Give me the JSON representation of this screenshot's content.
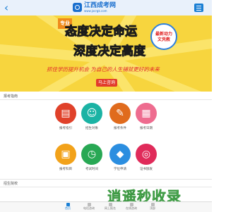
{
  "header": {
    "back_glyph": "‹",
    "logo_text": "江西成考网",
    "logo_sub": "www.jxcrgk.com",
    "menu_label": "menu"
  },
  "banner": {
    "tag": "专业",
    "headline_1": "态度决定命运",
    "headline_2": "深度决定高度",
    "badge": "最新动力\n文凭教",
    "slogan": "抓住学历提升机会 为自己的人生铺就更好的未来",
    "cta": "马上咨询",
    "colors": {
      "background": "#f7d53e",
      "tag": "#f08a1a",
      "cta": "#e23b2b"
    }
  },
  "sections": {
    "guide_title": "报考指南",
    "service_title": "招生院校"
  },
  "grid": [
    {
      "label": "报考指引",
      "icon": "document-icon",
      "color": "#e0412a"
    },
    {
      "label": "招生对象",
      "icon": "person-icon",
      "color": "#1bb3a4"
    },
    {
      "label": "报考条件",
      "icon": "certificate-icon",
      "color": "#e06b1d"
    },
    {
      "label": "报考日期",
      "icon": "calendar-icon",
      "color": "#ee6c8f"
    },
    {
      "label": "报考科目",
      "icon": "book-icon",
      "color": "#f2a21a"
    },
    {
      "label": "考试时间",
      "icon": "clock-icon",
      "color": "#28a854"
    },
    {
      "label": "学位申请",
      "icon": "graduation-cap-icon",
      "color": "#2b8ee0"
    },
    {
      "label": "证书颁发",
      "icon": "seal-icon",
      "color": "#e02b5a"
    }
  ],
  "watermark": "逍遥秒收录",
  "tabs": [
    {
      "label": "首页",
      "color": "#1a7fd4",
      "active": true
    },
    {
      "label": "电话咨询",
      "color": "#bdbdbd"
    },
    {
      "label": "网上报名",
      "color": "#bdbdbd"
    },
    {
      "label": "在线咨询",
      "color": "#bdbdbd"
    },
    {
      "label": "顶部",
      "color": "#bdbdbd"
    }
  ]
}
